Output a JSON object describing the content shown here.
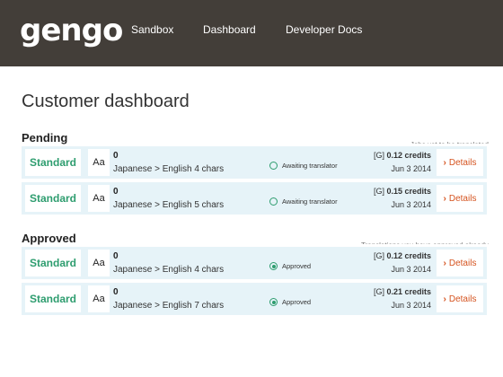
{
  "header": {
    "logo": "gengo",
    "nav": [
      "Sandbox",
      "Dashboard",
      "Developer Docs"
    ]
  },
  "page_title": "Customer dashboard",
  "sections": [
    {
      "title": "Pending",
      "note": "Jobs yet to be translated",
      "jobs": [
        {
          "tier": "Standard",
          "type": "Aa",
          "count": "0",
          "desc": "Japanese > English 4 chars",
          "status": "Awaiting translator",
          "credits_prefix": "[G]",
          "credits": "0.12 credits",
          "date": "Jun 3 2014",
          "details": "Details"
        },
        {
          "tier": "Standard",
          "type": "Aa",
          "count": "0",
          "desc": "Japanese > English 5 chars",
          "status": "Awaiting translator",
          "credits_prefix": "[G]",
          "credits": "0.15 credits",
          "date": "Jun 3 2014",
          "details": "Details"
        }
      ]
    },
    {
      "title": "Approved",
      "note": "Translations you have approved already",
      "jobs": [
        {
          "tier": "Standard",
          "type": "Aa",
          "count": "0",
          "desc": "Japanese > English 4 chars",
          "status": "Approved",
          "credits_prefix": "[G]",
          "credits": "0.12 credits",
          "date": "Jun 3 2014",
          "details": "Details"
        },
        {
          "tier": "Standard",
          "type": "Aa",
          "count": "0",
          "desc": "Japanese > English 7 chars",
          "status": "Approved",
          "credits_prefix": "[G]",
          "credits": "0.21 credits",
          "date": "Jun 3 2014",
          "details": "Details"
        }
      ]
    }
  ],
  "colors": {
    "header_bg": "#433e39",
    "row_bg": "#e6f3f8",
    "tier_green": "#2e9d6f",
    "details_orange": "#d5531f"
  },
  "icons": {
    "status_pending": "circle-outline-icon",
    "status_approved": "circle-filled-icon",
    "details": "chevron-right-icon"
  }
}
